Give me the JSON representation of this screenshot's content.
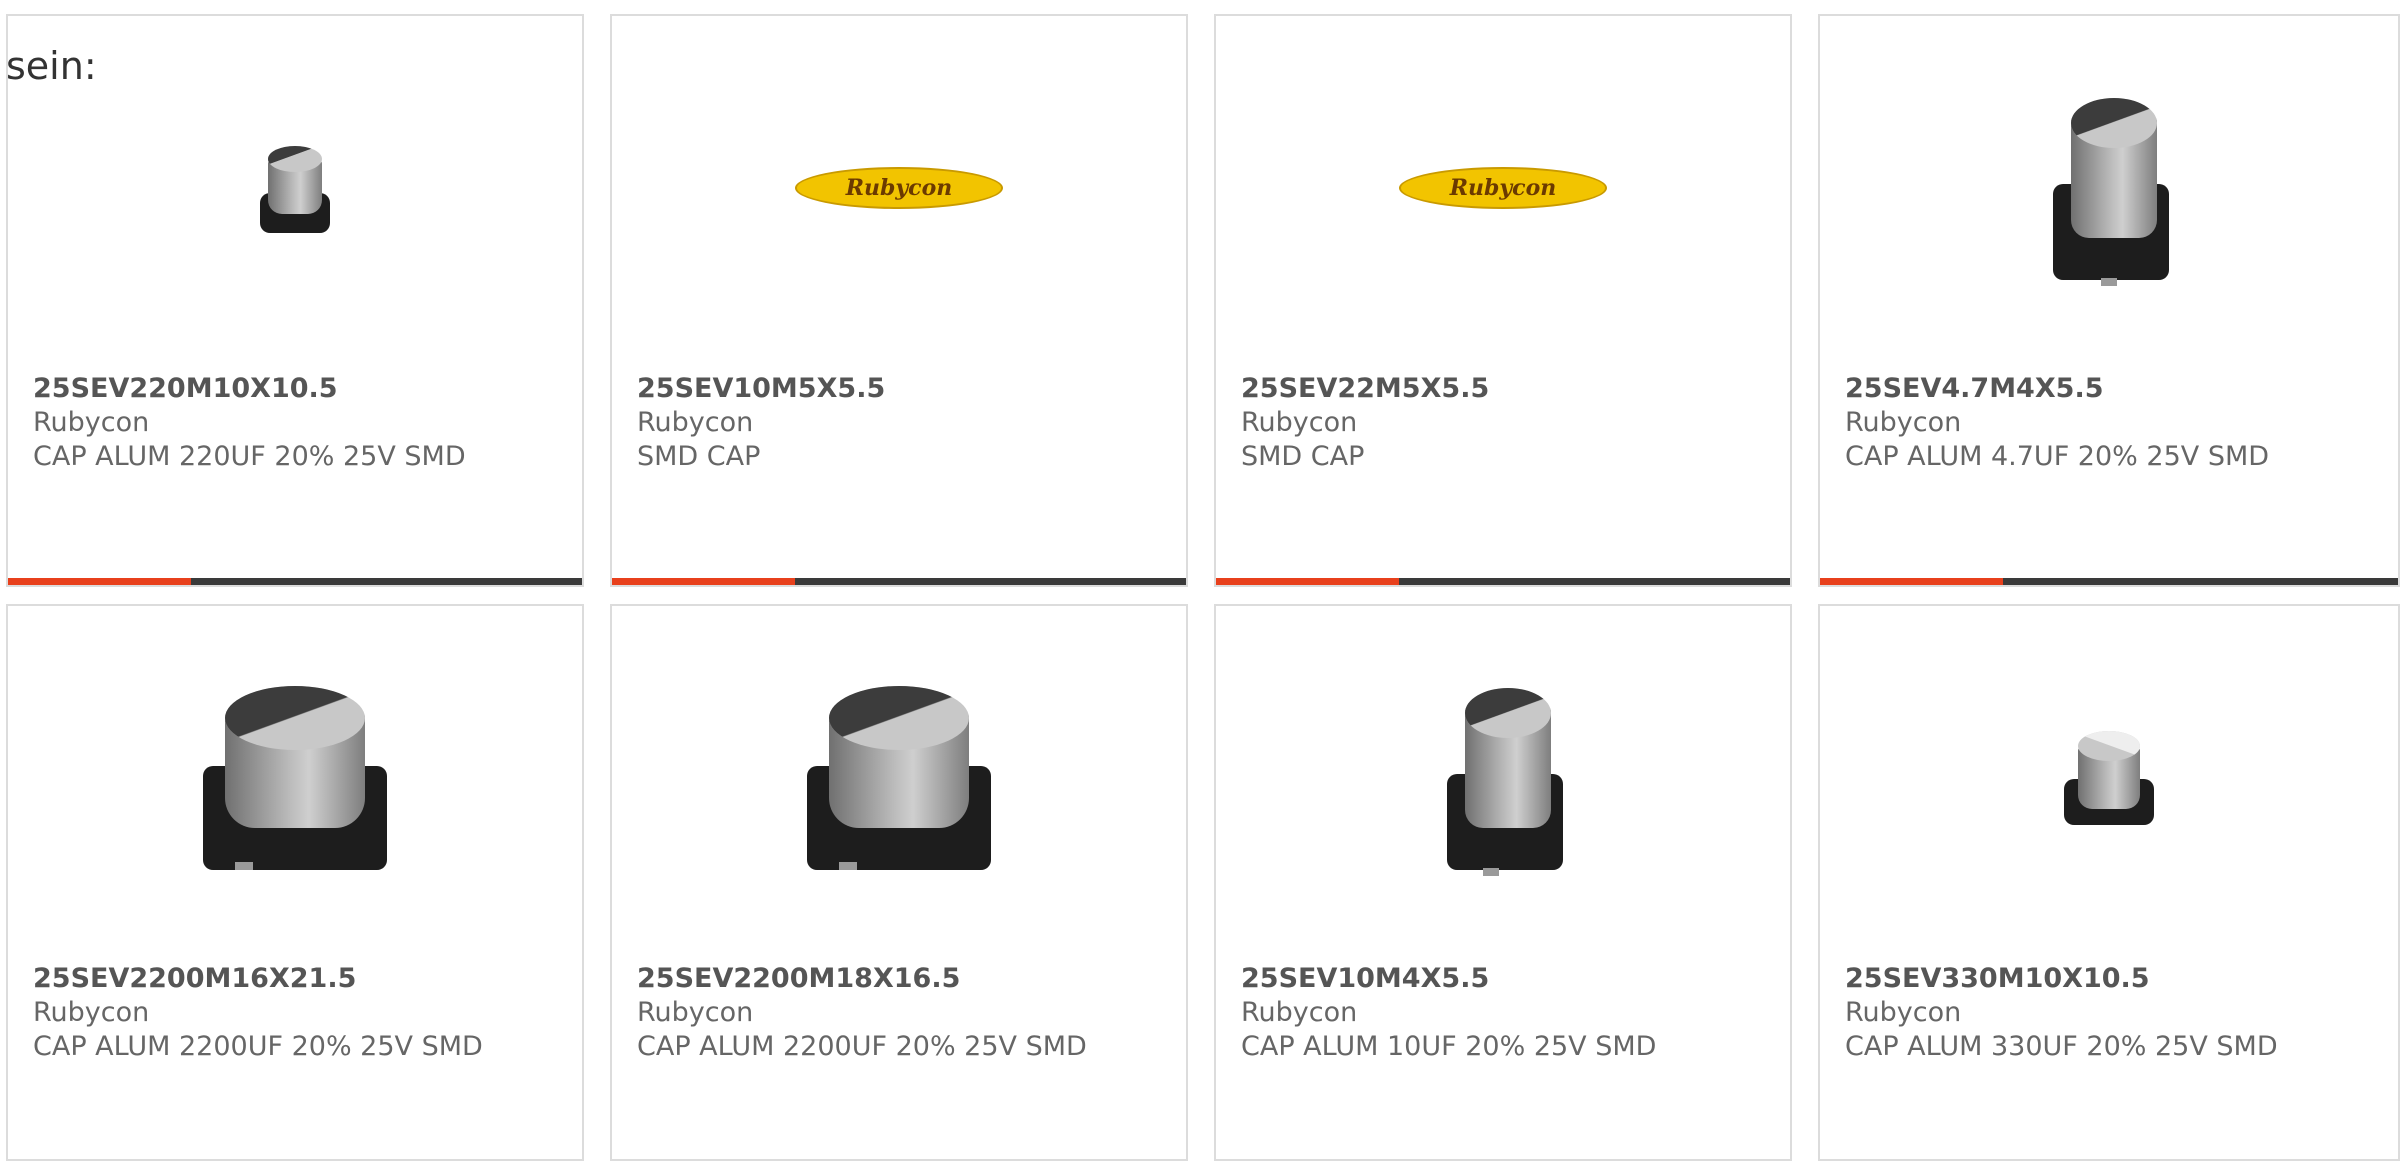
{
  "intro_text": "sein:",
  "accent_color": "#e8401c",
  "bar_color": "#3a3a3a",
  "products": [
    {
      "part": "25SEV220M10X10.5",
      "brand": "Rubycon",
      "desc": "CAP ALUM 220UF 20% 25V SMD",
      "image": "capacitor-small-icon"
    },
    {
      "part": "25SEV10M5X5.5",
      "brand": "Rubycon",
      "desc": "SMD CAP",
      "image": "rubycon-logo",
      "logo_text": "Rubycon"
    },
    {
      "part": "25SEV22M5X5.5",
      "brand": "Rubycon",
      "desc": "SMD CAP",
      "image": "rubycon-logo",
      "logo_text": "Rubycon"
    },
    {
      "part": "25SEV4.7M4X5.5",
      "brand": "Rubycon",
      "desc": "CAP ALUM 4.7UF 20% 25V SMD",
      "image": "capacitor-tall-icon"
    },
    {
      "part": "25SEV2200M16X21.5",
      "brand": "Rubycon",
      "desc": "CAP ALUM 2200UF 20% 25V SMD",
      "image": "capacitor-large-icon"
    },
    {
      "part": "25SEV2200M18X16.5",
      "brand": "Rubycon",
      "desc": "CAP ALUM 2200UF 20% 25V SMD",
      "image": "capacitor-large-icon"
    },
    {
      "part": "25SEV10M4X5.5",
      "brand": "Rubycon",
      "desc": "CAP ALUM 10UF 20% 25V SMD",
      "image": "capacitor-tall-icon"
    },
    {
      "part": "25SEV330M10X10.5",
      "brand": "Rubycon",
      "desc": "CAP ALUM 330UF 20% 25V SMD",
      "image": "capacitor-small-icon"
    }
  ]
}
